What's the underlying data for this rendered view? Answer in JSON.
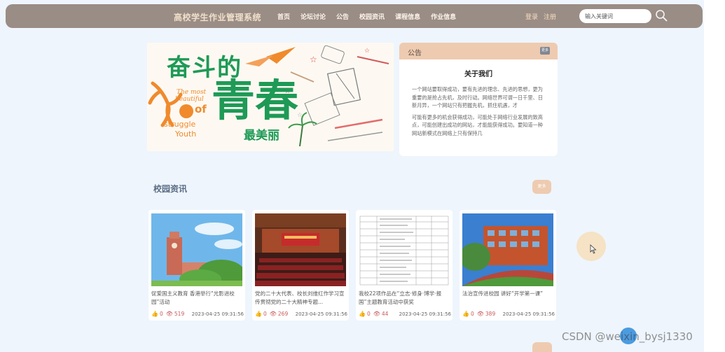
{
  "header": {
    "brand": "高校学生作业管理系统",
    "nav": [
      "首页",
      "论坛讨论",
      "公告",
      "校园资讯",
      "课程信息",
      "作业信息"
    ],
    "login": "登录",
    "register": "注册",
    "search_placeholder": "输入关键词"
  },
  "banner": {
    "headline_top": "奋斗的",
    "headline_big": "青春",
    "headline_sub": "最美丽",
    "en_lines": [
      "The most",
      "beautiful",
      "of",
      "struggle",
      "Youth"
    ]
  },
  "notice": {
    "title": "公告",
    "more": "更多",
    "about_title": "关于我们",
    "paragraphs": [
      "一个网站要取得成功，要有先进的理念、先进的思想，更为重要的是抢占先机，及时行动。网络世界可谓一日千里、日新月异，一个网站只有把握先机，抓住机遇，才",
      "可能有更多的机会获得成功，可能处于网络行业发展的致高点，可能创建出成功的网站，才能能获得成功。要知道一种网站新模式在网络上只有保持几"
    ]
  },
  "news": {
    "title": "校园资讯",
    "more": "更多",
    "items": [
      {
        "title": "促爱国主义教育 香港举行“光影进校园”活动",
        "likes": "0",
        "views": "519",
        "date": "2023-04-25 09:31:56"
      },
      {
        "title": "党的二十大代表、校长刘维红作学习宣传贯彻党的二十大精神专题...",
        "likes": "0",
        "views": "269",
        "date": "2023-04-25 09:31:56"
      },
      {
        "title": "我校22项作品在“立志·修身·博学·报国”主题教育活动中获奖",
        "likes": "0",
        "views": "44",
        "date": "2023-04-25 09:31:56"
      },
      {
        "title": "法治宣传进校园 讲好“开学第一课”",
        "likes": "0",
        "views": "389",
        "date": "2023-04-25 09:31:56"
      }
    ]
  },
  "watermark": "CSDN @weixin_bysj1330",
  "colors": {
    "header_bg": "#9a8d86",
    "accent": "#eecbb0",
    "page_bg": "#eef5fc",
    "news_title": "#5b6d85",
    "banner_green": "#1e9a56",
    "banner_orange": "#f08a2c"
  }
}
